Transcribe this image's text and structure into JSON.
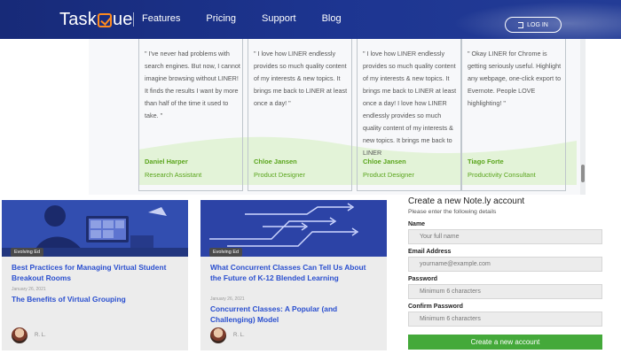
{
  "nav": {
    "logo": {
      "part1": "Task",
      "part2": "ue"
    },
    "items": [
      "Features",
      "Pricing",
      "Support",
      "Blog"
    ],
    "login": "LOG IN"
  },
  "testimonials": [
    {
      "quote": "\" I've never had problems with search engines. But now, I cannot imagine browsing without LINER!\nIt finds the results I want by more than half of the time it used to take. \"",
      "name": "Daniel Harper",
      "role": "Research Assistant"
    },
    {
      "quote": "\" I love how LINER endlessly provides so much quality content of my interests & new topics. It brings me back to LINER at least once a day! \"",
      "name": "Chloe Jansen",
      "role": "Product Designer"
    },
    {
      "quote": "\" I love how LINER endlessly provides so much quality content of my interests & new topics. It brings me back to LINER at least once a day! I love how LINER endlessly provides so much quality content of my interests & new topics. It brings me back to LINER",
      "name": "Chloe Jansen",
      "role": "Product Designer"
    },
    {
      "quote": "\" Okay LINER for Chrome is getting seriously useful. Highlight any webpage, one-click export to Evernote. People LOVE highlighting! \"",
      "name": "Tiago Forte",
      "role": "Productivity Consultant"
    }
  ],
  "articles": [
    {
      "badge": "Evolving Ed",
      "title": "Best Practices for Managing Virtual Student Breakout Rooms",
      "date": "January 26, 2021",
      "title2": "The Benefits of Virtual Grouping",
      "author": "R. L."
    },
    {
      "badge": "Evolving Ed",
      "title": "What Concurrent Classes Can Tell Us About the Future of K-12 Blended Learning",
      "date": "January 26, 2021",
      "title2": "Concurrent Classes: A Popular (and Challenging) Model",
      "author": "R. L."
    }
  ],
  "form": {
    "title": "Create a new Note.ly account",
    "subtitle": "Please enter the following details",
    "fields": [
      {
        "label": "Name",
        "placeholder": "Your full name"
      },
      {
        "label": "Email Address",
        "placeholder": "yourname@example.com"
      },
      {
        "label": "Password",
        "placeholder": "Minimum 6 characters"
      },
      {
        "label": "Confirm Password",
        "placeholder": "Minimum 6 characters"
      }
    ],
    "submit": "Create a new account"
  },
  "colors": {
    "nav": "#1d3591",
    "accent_green": "#5aa51c",
    "link_blue": "#2a4fcf",
    "button_green": "#44a93a",
    "logo_orange": "#ff8a1f"
  }
}
